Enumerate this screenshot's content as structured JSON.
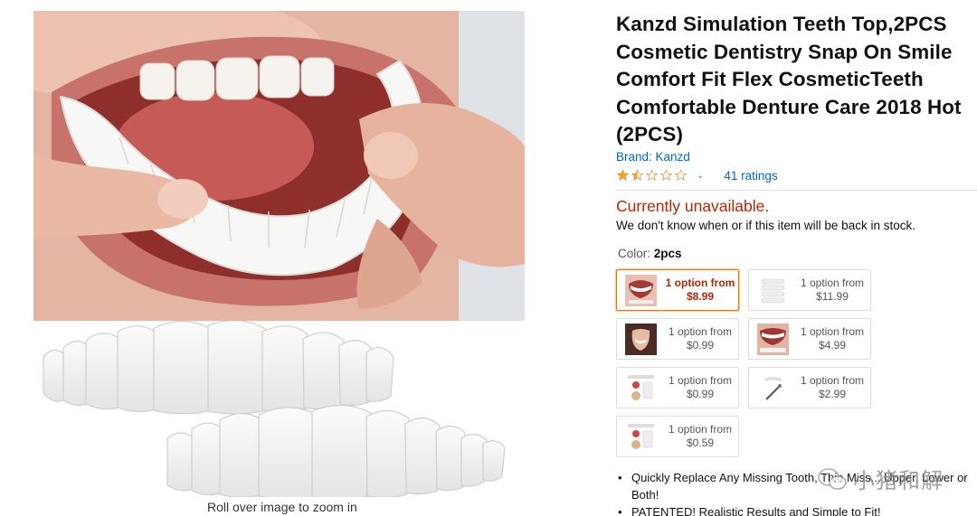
{
  "product": {
    "title": "Kanzd Simulation Teeth Top,2PCS Cosmetic Dentistry Snap On Smile Comfort Fit Flex CosmeticTeeth Comfortable Denture Care 2018 Hot (2PCS)",
    "brand": "Brand: Kanzd",
    "rating_stars": 1.5,
    "ratings_count": "41 ratings"
  },
  "availability": {
    "status": "Currently unavailable.",
    "note": "We don't know when or if this item will be back in stock."
  },
  "color": {
    "label": "Color: ",
    "value": "2pcs"
  },
  "options": [
    {
      "line1": "1 option from",
      "price": "$8.99",
      "selected": true
    },
    {
      "line1": "1 option from",
      "price": "$11.99",
      "selected": false
    },
    {
      "line1": "1 option from",
      "price": "$0.99",
      "selected": false
    },
    {
      "line1": "1 option from",
      "price": "$4.99",
      "selected": false
    },
    {
      "line1": "1 option from",
      "price": "$0.99",
      "selected": false
    },
    {
      "line1": "1 option from",
      "price": "$2.99",
      "selected": false
    },
    {
      "line1": "1 option from",
      "price": "$0.59",
      "selected": false
    }
  ],
  "bullets": [
    "Quickly Replace Any Missing Tooth, Thin Miss... Upper, Lower or Both!",
    "PATENTED! Realistic Results and Simple to Fit!"
  ],
  "image": {
    "zoom_hint": "Roll over image to zoom in"
  },
  "watermark": {
    "text": "小猪和解"
  },
  "colors": {
    "link": "#0066c0",
    "price_red": "#b12704",
    "selected_border": "#e77600",
    "star": "#ffa41c"
  }
}
